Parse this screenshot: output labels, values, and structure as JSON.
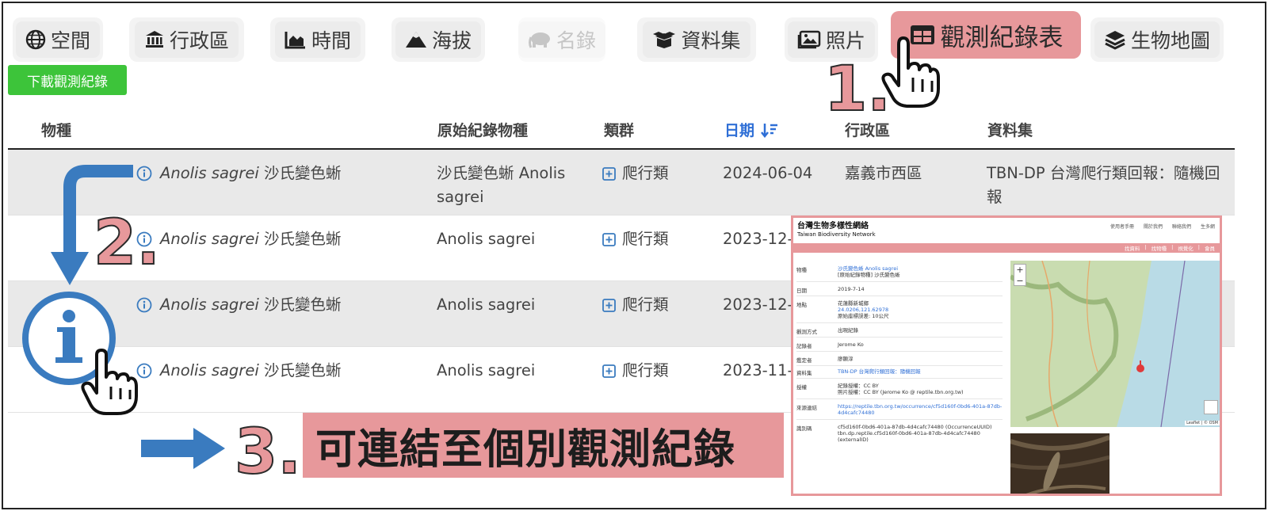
{
  "tabs": [
    {
      "label": "空間",
      "icon": "globe-icon"
    },
    {
      "label": "行政區",
      "icon": "landmark-icon"
    },
    {
      "label": "時間",
      "icon": "chart-area-icon"
    },
    {
      "label": "海拔",
      "icon": "mountain-icon"
    },
    {
      "label": "名錄",
      "icon": "elephant-icon",
      "disabled": true
    },
    {
      "label": "資料集",
      "icon": "box-open-icon"
    },
    {
      "label": "照片",
      "icon": "photo-icon"
    },
    {
      "label": "觀測紀錄表",
      "icon": "table-icon",
      "active": true
    },
    {
      "label": "生物地圖",
      "icon": "layers-icon"
    }
  ],
  "download_label": "下載觀測紀錄",
  "table": {
    "headers": {
      "species": "物種",
      "original": "原始紀錄物種",
      "group": "類群",
      "date": "日期",
      "district": "行政區",
      "dataset": "資料集"
    },
    "rows": [
      {
        "sci": "Anolis sagrei",
        "zh": "沙氏變色蜥",
        "original_l1": "沙氏變色蜥 Anolis",
        "original_l2": "sagrei",
        "group": "爬行類",
        "date": "2024-06-04",
        "district": "嘉義市西區",
        "dataset_l1": "TBN-DP 台灣爬行類回報：隨機回",
        "dataset_l2": "報"
      },
      {
        "sci": "Anolis sagrei",
        "zh": "沙氏變色蜥",
        "original_l1": "Anolis sagrei",
        "original_l2": "",
        "group": "爬行類",
        "date": "2023-12-"
      },
      {
        "sci": "Anolis sagrei",
        "zh": "沙氏變色蜥",
        "original_l1": "Anolis sagrei",
        "original_l2": "",
        "group": "爬行類",
        "date": "2023-12-"
      },
      {
        "sci": "Anolis sagrei",
        "zh": "沙氏變色蜥",
        "original_l1": "Anolis sagrei",
        "original_l2": "",
        "group": "爬行類",
        "date": "2023-11-"
      }
    ]
  },
  "annotations": {
    "step1": "1.",
    "step2": "2.",
    "step3": "3.",
    "callout": "可連結至個別觀測紀錄"
  },
  "inset": {
    "logo": "台灣生物多樣性網絡",
    "logo_en": "Taiwan Biodiversity Network",
    "top_links": [
      "使用者手冊",
      "關於我們",
      "聯絡我們",
      "生多網"
    ],
    "bar_links": [
      "找資料",
      "找物種",
      "視覺化",
      "會員"
    ],
    "fields": [
      {
        "label": "物種",
        "value": "沙氏變色蜥 Anolis sagrei",
        "value2": "[原始紀錄物種] 沙氏變色蜥",
        "link": true
      },
      {
        "label": "日期",
        "value": "2019-7-14"
      },
      {
        "label": "地點",
        "value": "花蓮縣新城鄉",
        "value2": "24.0206,121.62978",
        "value3": "原始座標誤差: 10公尺"
      },
      {
        "label": "觀測方式",
        "value": "出現紀錄"
      },
      {
        "label": "記錄者",
        "value": "Jerome Ko"
      },
      {
        "label": "鑑定者",
        "value": "廖顯淳"
      },
      {
        "label": "資料集",
        "value": "TBN-DP 台灣爬行類回報：隨機回報",
        "link": true
      },
      {
        "label": "授權",
        "value": "紀錄授權：CC BY",
        "value2": "照片授權：CC BY (Jerome Ko @ reptile.tbn.org.tw)"
      },
      {
        "label": "來源連結",
        "value": "https://reptile.tbn.org.tw/occurrence/cf5d160f-0bd6-401a-87db-",
        "value2": "4d4cafc74480",
        "link": true
      },
      {
        "label": "識別碼",
        "value": "cf5d160f-0bd6-401a-87db-4d4cafc74480 (OccurrenceUUID)",
        "value2": "tbn.dp.reptile.cf5d160f-0bd6-401a-87db-4d4cafc74480 (externalID)"
      }
    ],
    "map_credit": "Leaflet | © OSM",
    "zoom_in": "+",
    "zoom_out": "−"
  },
  "colors": {
    "accent": "#e7989b",
    "download": "#3dc43a",
    "link": "#2f6fd6",
    "arrow": "#3a7bbf"
  }
}
